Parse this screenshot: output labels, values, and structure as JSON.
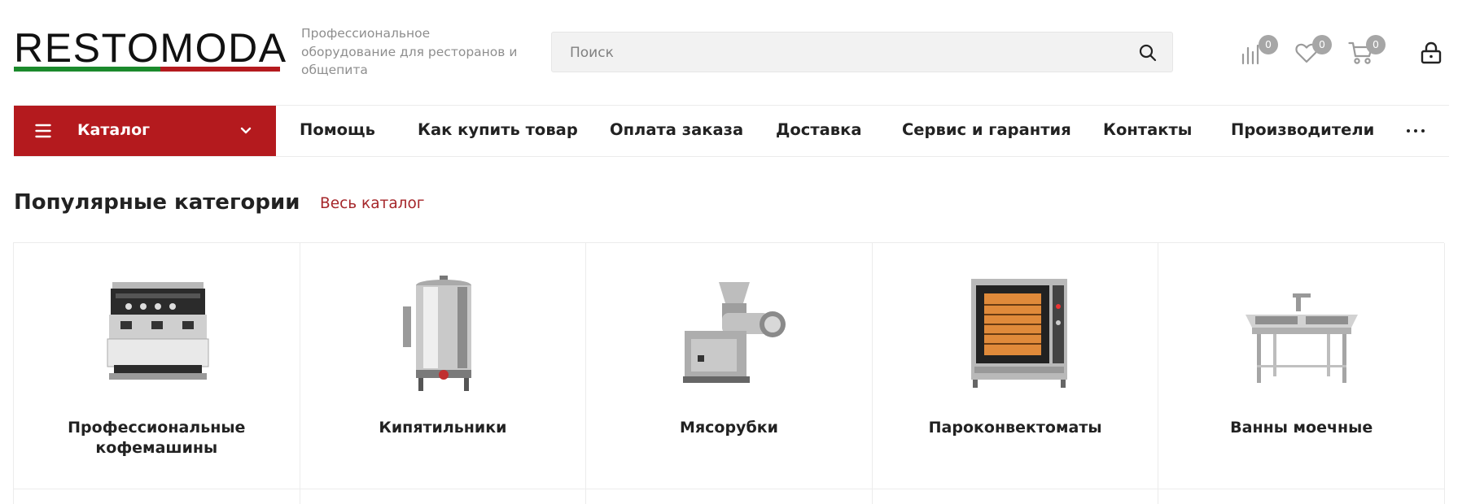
{
  "header": {
    "logo_text": "RESTOMODA",
    "tagline": "Профессиональное оборудование для ресторанов и общепита",
    "search": {
      "placeholder": "Поиск"
    },
    "icons": [
      {
        "name": "compare-icon",
        "count": "0"
      },
      {
        "name": "favorites-icon",
        "count": "0"
      },
      {
        "name": "cart-icon",
        "count": "0"
      },
      {
        "name": "lock-icon"
      }
    ]
  },
  "nav": {
    "catalog_label": "Каталог",
    "items": [
      {
        "label": "Помощь"
      },
      {
        "label": "Как купить товар"
      },
      {
        "label": "Оплата заказа"
      },
      {
        "label": "Доставка"
      },
      {
        "label": "Сервис и гарантия"
      },
      {
        "label": "Контакты"
      },
      {
        "label": "Производители"
      }
    ],
    "more_icon": "more-dots-icon"
  },
  "section": {
    "title": "Популярные категории",
    "all_link": "Весь каталог"
  },
  "categories": [
    {
      "label": "Профессиональные кофемашины",
      "image": "coffee-machine-image"
    },
    {
      "label": "Кипятильники",
      "image": "water-boiler-image"
    },
    {
      "label": "Мясорубки",
      "image": "meat-grinder-image"
    },
    {
      "label": "Пароконвектоматы",
      "image": "combi-oven-image"
    },
    {
      "label": "Ванны моечные",
      "image": "sink-image"
    }
  ],
  "colors": {
    "accent": "#b41a1e",
    "logo_green": "#1b8a2c",
    "link": "#a5262a",
    "badge": "#a6a6a6"
  }
}
